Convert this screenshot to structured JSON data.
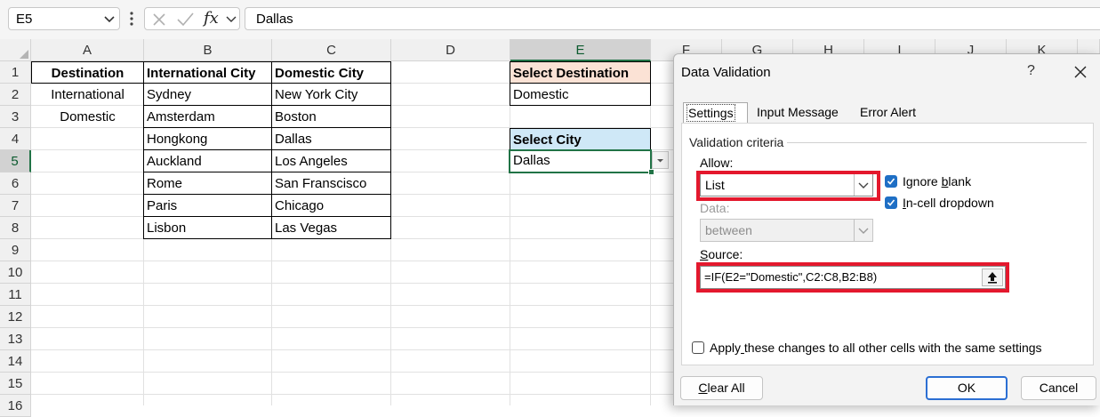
{
  "formula_bar": {
    "name_box": "E5",
    "fx_label": "fx",
    "formula_value": "Dallas"
  },
  "columns": [
    "A",
    "B",
    "C",
    "D",
    "E",
    "F",
    "G",
    "H",
    "I",
    "J",
    "K"
  ],
  "rows": [
    "1",
    "2",
    "3",
    "4",
    "5",
    "6",
    "7",
    "8",
    "9",
    "10",
    "11",
    "12",
    "13",
    "14",
    "15",
    "16"
  ],
  "sheet": {
    "a_header": "Destination",
    "a_values": [
      "International",
      "Domestic"
    ],
    "b_header": "International City",
    "b_values": [
      "Sydney",
      "Amsterdam",
      "Hongkong",
      "Auckland",
      "Rome",
      "Paris",
      "Lisbon"
    ],
    "c_header": "Domestic City",
    "c_values": [
      "New York City",
      "Boston",
      "Dallas",
      "Los Angeles",
      "San Franscisco",
      "Chicago",
      "Las Vegas"
    ],
    "e1": "Select Destination",
    "e2": "Domestic",
    "e4": "Select City",
    "e5": "Dallas"
  },
  "dialog": {
    "title": "Data Validation",
    "help": "?",
    "tabs": [
      "Settings",
      "Input Message",
      "Error Alert"
    ],
    "group_label": "Validation criteria",
    "allow_label": "Allow:",
    "allow_value": "List",
    "ignore_blank_pre": "Ignore ",
    "ignore_blank_u": "b",
    "ignore_blank_post": "lank",
    "incell_u": "I",
    "incell_post": "n-cell dropdown",
    "data_label": "Data:",
    "data_value": "between",
    "source_label_u": "S",
    "source_label_post": "ource:",
    "source_value": "=IF(E2=\"Domestic\",C2:C8,B2:B8)",
    "apply_pre": "Apply",
    "apply_u": " ",
    "apply_post": "these changes to all other cells with the same settings",
    "clear_u": "C",
    "clear_post": "lear All",
    "ok": "OK",
    "cancel": "Cancel"
  },
  "colors": {
    "accent_green": "#217346",
    "highlight_red": "#e4182d",
    "checkbox_blue": "#1f6fc5",
    "peach_fill": "#fbe2d5",
    "blue_fill": "#cfe8f7"
  },
  "icons": [
    "chevron-down-icon",
    "more-dots-icon",
    "cancel-x-icon",
    "enter-check-icon",
    "upload-arrow-icon",
    "close-icon",
    "select-all-triangle-icon"
  ]
}
